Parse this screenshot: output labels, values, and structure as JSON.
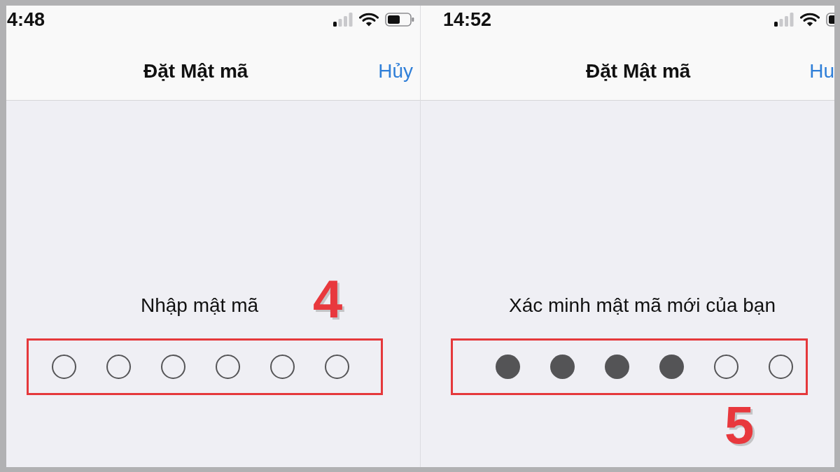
{
  "panels": [
    {
      "status_bar": {
        "time": "4:48"
      },
      "nav_bar": {
        "title": "Đặt Mật mã",
        "cancel": "Hủy"
      },
      "prompt": "Nhập mật mã",
      "passcode_dots": [
        {
          "filled": false
        },
        {
          "filled": false
        },
        {
          "filled": false
        },
        {
          "filled": false
        },
        {
          "filled": false
        },
        {
          "filled": false
        }
      ],
      "step_number": "4"
    },
    {
      "status_bar": {
        "time": "14:52"
      },
      "nav_bar": {
        "title": "Đặt Mật mã",
        "cancel": "Hu"
      },
      "prompt": "Xác minh mật mã mới của bạn",
      "passcode_dots": [
        {
          "filled": true
        },
        {
          "filled": true
        },
        {
          "filled": true
        },
        {
          "filled": true
        },
        {
          "filled": false
        },
        {
          "filled": false
        }
      ],
      "step_number": "5"
    }
  ]
}
